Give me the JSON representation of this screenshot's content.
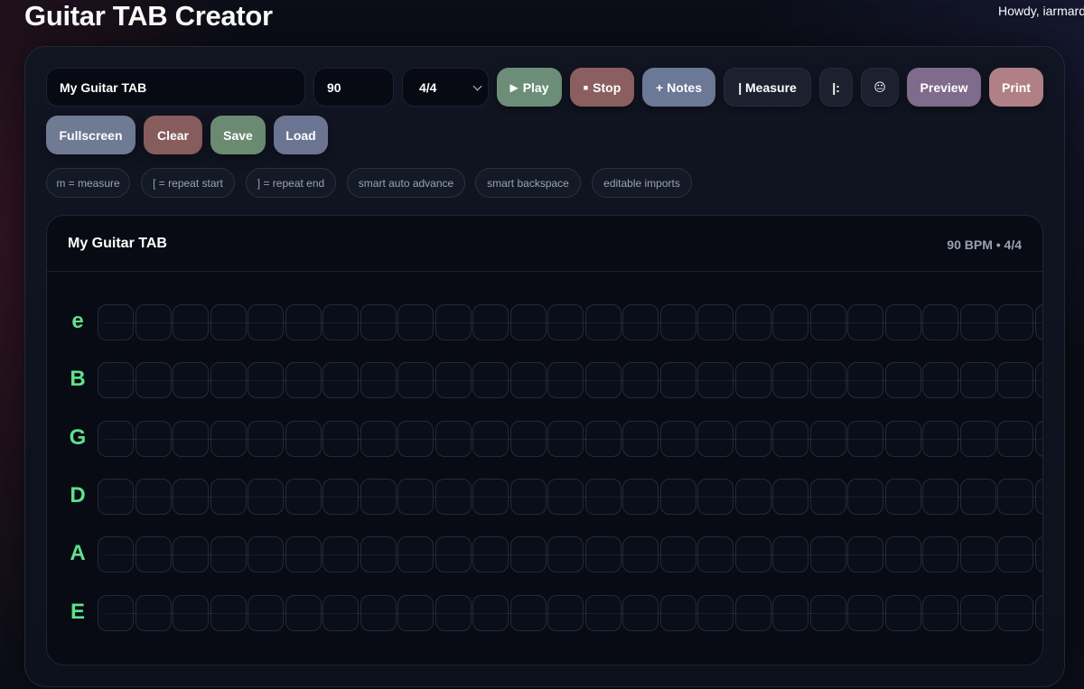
{
  "header": {
    "title": "Guitar TAB Creator",
    "greeting": "Howdy, iarmard"
  },
  "toolbar": {
    "title_value": "My Guitar TAB",
    "bpm_value": "90",
    "time_signature": "4/4",
    "play_label": "Play",
    "stop_label": "Stop",
    "notes_label": "+ Notes",
    "measure_label": "| Measure",
    "repeat_label": "|:",
    "emoji": "😐",
    "preview_label": "Preview",
    "print_label": "Print",
    "fullscreen_label": "Fullscreen",
    "clear_label": "Clear",
    "save_label": "Save",
    "load_label": "Load"
  },
  "hints": [
    "m = measure",
    "[ = repeat start",
    "] = repeat end",
    "smart auto advance",
    "smart backspace",
    "editable imports"
  ],
  "tab": {
    "title": "My Guitar TAB",
    "meta": "90 BPM • 4/4",
    "strings": [
      "e",
      "B",
      "G",
      "D",
      "A",
      "E"
    ]
  },
  "colors": {
    "string_label": "#5fe08a",
    "play": "#6c8e79",
    "stop": "#8b5f5f",
    "notes": "#6b7896",
    "preview": "#7f6b8c",
    "print": "#b08086",
    "fullscreen": "#6f7a93",
    "clear": "#875c5c",
    "save": "#6a8a72",
    "load": "#6b7592"
  }
}
